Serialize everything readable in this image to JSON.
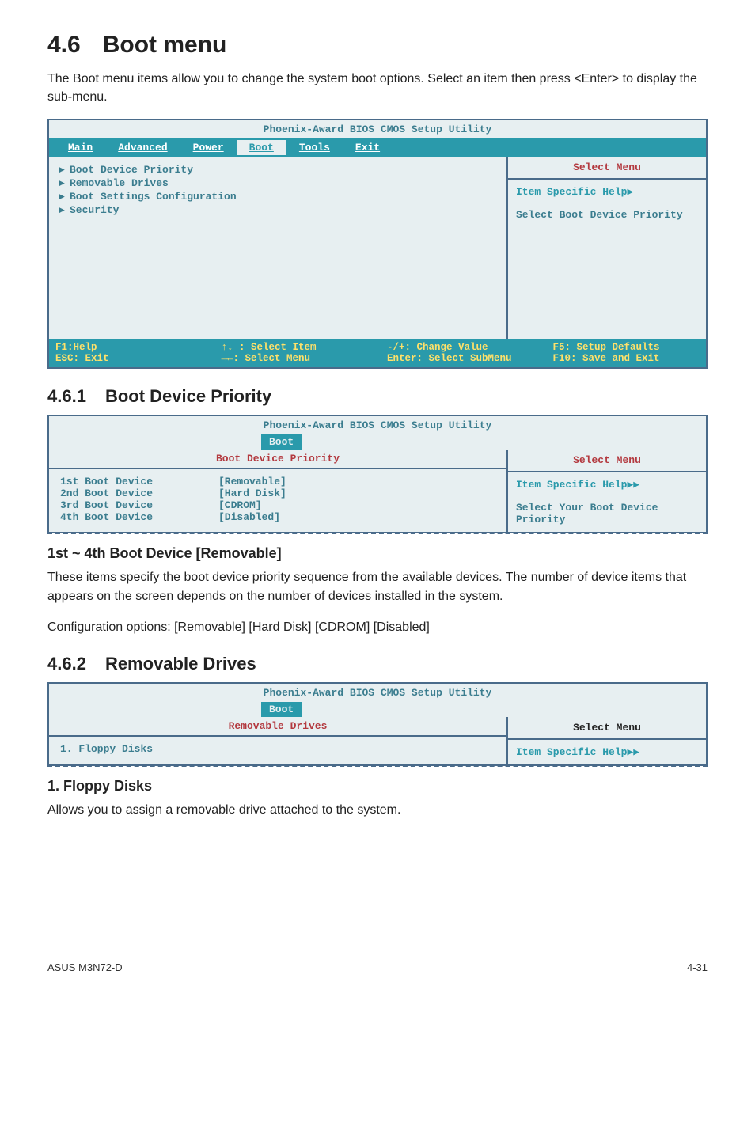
{
  "section": {
    "title_num": "4.6",
    "title_text": "Boot menu",
    "intro": "The Boot menu items allow you to change the system boot options. Select an item then press <Enter> to display the sub-menu."
  },
  "bios_main": {
    "title": "Phoenix-Award BIOS CMOS Setup Utility",
    "menus": [
      "Main",
      "Advanced",
      "Power",
      "Boot",
      "Tools",
      "Exit"
    ],
    "active_menu": "Boot",
    "items": [
      "Boot Device Priority",
      "Removable Drives",
      "Boot Settings Configuration",
      "Security"
    ],
    "select_menu": "Select Menu",
    "help_label": "Item Specific Help",
    "help_desc": "Select Boot Device Priority",
    "footer": {
      "c1a": "F1:Help",
      "c1b": "ESC: Exit",
      "c2a": "↑↓ : Select Item",
      "c2b": "→←: Select Menu",
      "c3a": "-/+: Change Value",
      "c3b": "Enter: Select SubMenu",
      "c4a": "F5: Setup Defaults",
      "c4b": "F10: Save and Exit"
    }
  },
  "sub1": {
    "num": "4.6.1",
    "title": "Boot Device Priority",
    "panel_title": "Phoenix-Award BIOS CMOS Setup Utility",
    "tab": "Boot",
    "panel_head": "Boot Device Priority",
    "select_menu": "Select Menu",
    "rows": [
      {
        "k": "1st Boot Device",
        "v": "[Removable]"
      },
      {
        "k": "2nd Boot Device",
        "v": "[Hard Disk]"
      },
      {
        "k": "3rd Boot Device",
        "v": "[CDROM]"
      },
      {
        "k": "4th Boot Device",
        "v": "[Disabled]"
      }
    ],
    "help_label": "Item Specific Help",
    "help_desc": "Select Your Boot Device Priority",
    "field_head": "1st ~ 4th Boot Device [Removable]",
    "para1": "These items specify the boot device priority sequence from the available devices. The number of device items that appears on the screen depends on the number of devices installed in the system.",
    "para2": "Configuration options: [Removable] [Hard Disk] [CDROM] [Disabled]"
  },
  "sub2": {
    "num": "4.6.2",
    "title": "Removable Drives",
    "panel_title": "Phoenix-Award BIOS CMOS Setup Utility",
    "tab": "Boot",
    "panel_head": "Removable Drives",
    "select_menu": "Select Menu",
    "row": "1. Floppy Disks",
    "help_label": "Item Specific Help",
    "field_head": "1. Floppy Disks",
    "para": "Allows you to assign a removable drive attached to the system."
  },
  "footer": {
    "left": "ASUS M3N72-D",
    "right": "4-31"
  }
}
